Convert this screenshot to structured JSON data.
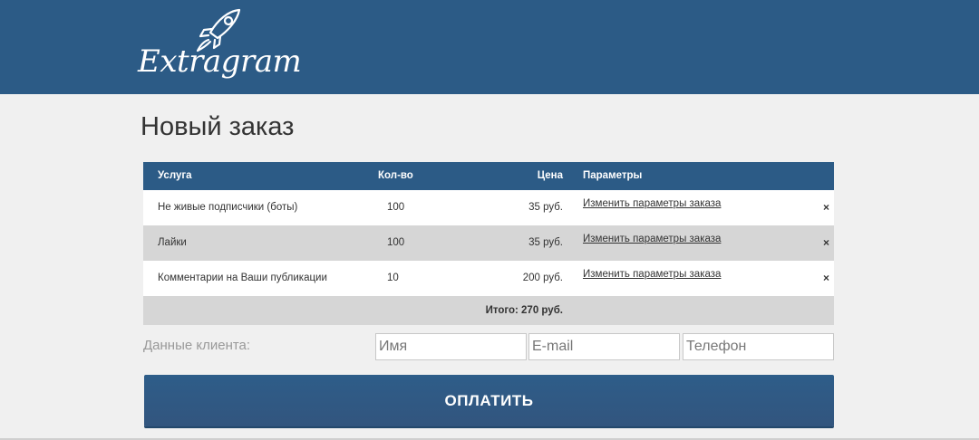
{
  "brand": {
    "name": "Extragram"
  },
  "page": {
    "title": "Новый заказ"
  },
  "table": {
    "headers": {
      "service": "Услуга",
      "qty": "Кол-во",
      "price": "Цена",
      "params": "Параметры"
    },
    "rows": [
      {
        "service": "Не живые подписчики (боты)",
        "qty": "100",
        "price": "35 руб.",
        "params_link": "Изменить параметры заказа",
        "remove": "×"
      },
      {
        "service": "Лайки",
        "qty": "100",
        "price": "35 руб.",
        "params_link": "Изменить параметры заказа",
        "remove": "×"
      },
      {
        "service": "Комментарии на Ваши публикации",
        "qty": "10",
        "price": "200 руб.",
        "params_link": "Изменить параметры заказа",
        "remove": "×"
      }
    ],
    "total": "Итого: 270 руб."
  },
  "client": {
    "label": "Данные клиента:",
    "name_placeholder": "Имя",
    "email_placeholder": "E-mail",
    "phone_placeholder": "Телефон"
  },
  "pay_button": {
    "label": "ОПЛАТИТЬ"
  },
  "colors": {
    "header": "#2c5b86",
    "background": "#f0f0f0",
    "row_alt": "#d6d6d6"
  }
}
